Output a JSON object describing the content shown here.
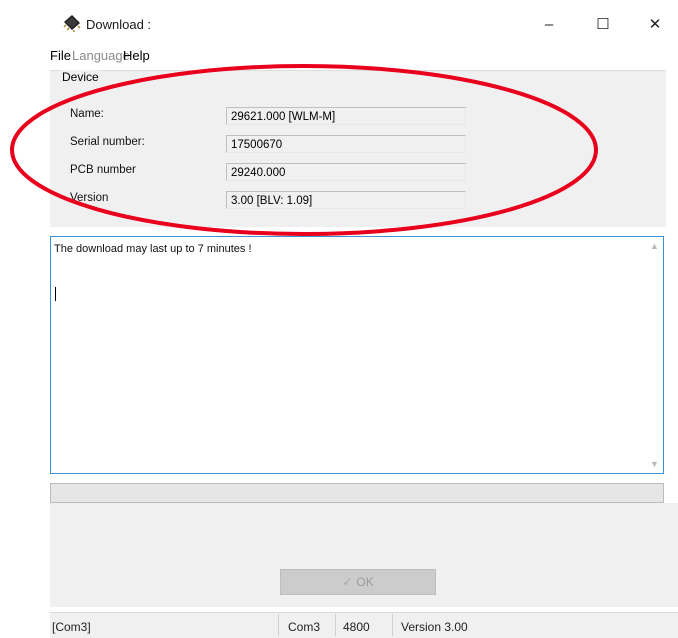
{
  "window": {
    "title": "Download :",
    "minimize_symbol": "–",
    "maximize_symbol": "☐",
    "close_symbol": "✕",
    "icon": "chip-icon"
  },
  "menu": {
    "items": [
      {
        "label": "File",
        "enabled": true
      },
      {
        "label": "Language",
        "enabled": false
      },
      {
        "label": "Help",
        "enabled": true
      }
    ]
  },
  "device": {
    "group_label": "Device",
    "fields": [
      {
        "label": "Name:",
        "value": "29621.000  [WLM-M]"
      },
      {
        "label": "Serial number:",
        "value": "17500670"
      },
      {
        "label": "PCB number",
        "value": "29240.000"
      },
      {
        "label": "Version",
        "value": "3.00  [BLV: 1.09]"
      }
    ]
  },
  "log": {
    "text": "The download may last up to 7 minutes !"
  },
  "progress": {
    "fraction": 0.0
  },
  "ok_button": {
    "label": "OK",
    "enabled": false
  },
  "status_bar": {
    "port": "[Com3]",
    "com": "Com3",
    "baud": "4800",
    "version": "Version  3.00"
  },
  "colors": {
    "annotation": "#e8001c",
    "log_border": "#3c8fd0",
    "panel_bg": "#f0f0f0"
  }
}
